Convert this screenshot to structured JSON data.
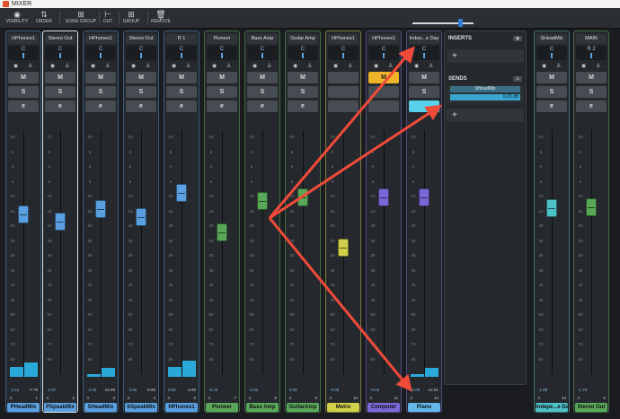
{
  "window": {
    "title": "MIXER"
  },
  "toolbar": {
    "buttons": [
      {
        "label": "VISIBILITY",
        "icon": "eye-icon"
      },
      {
        "label": "ORDER",
        "icon": "order-icon"
      },
      {
        "label": "SONG GROUP",
        "icon": "song-group-icon"
      },
      {
        "label": "OUT",
        "icon": "out-icon"
      },
      {
        "label": "GROUP",
        "icon": "group-icon"
      },
      {
        "label": "REMOVE",
        "icon": "trash-icon"
      }
    ]
  },
  "strip_buttons": {
    "mute": "M",
    "solo": "S",
    "edit": "e"
  },
  "strips": [
    {
      "name": "HPhones1",
      "pan": "C",
      "fader_db": -3.12,
      "val_l": "-3.12",
      "val_r": "-7.79",
      "num": "1",
      "label": "PHeadMix",
      "color": "#5aa0e0",
      "accent": "blue",
      "meter": [
        0.14,
        0.2
      ]
    },
    {
      "name": "Stereo Out",
      "pan": "C",
      "fader_db": -4.37,
      "val_l": "-4.37",
      "val_r": "",
      "num": "2",
      "label": "PSpeakMix",
      "color": "#5aa0e0",
      "accent": "blue",
      "selected": true,
      "meter": [
        0,
        0
      ]
    },
    {
      "name": "HPhones1",
      "pan": "C",
      "fader_db": -2.05,
      "val_l": "-2.05",
      "val_r": "-14.95",
      "num": "3",
      "label": "SHeadMix",
      "color": "#5aa0e0",
      "accent": "blue",
      "meter": [
        0.04,
        0.12
      ]
    },
    {
      "name": "Stereo Out",
      "pan": "C",
      "fader_db": -3.56,
      "val_l": "-3.56",
      "val_r": "-8.95",
      "num": "4",
      "label": "SSpeakMix",
      "color": "#5aa0e0",
      "accent": "blue",
      "meter": [
        0,
        0
      ]
    },
    {
      "name": "R 1",
      "pan": "C",
      "fader_db": 0.82,
      "val_l": "0.82",
      "val_r": "-3.60",
      "num": "6",
      "label": "HPhones1",
      "color": "#5aa0e0",
      "accent": "blue",
      "meter": [
        0.14,
        0.23
      ]
    },
    {
      "name": "Pioneer",
      "pan": "C",
      "fader_db": -6.29,
      "val_l": "-6.29",
      "val_r": "",
      "num": "7",
      "label": "Pioneer",
      "color": "#59a859",
      "accent": "green",
      "meter": [
        0,
        0
      ]
    },
    {
      "name": "Bass Amp",
      "pan": "C",
      "fader_db": -0.63,
      "val_l": "-0.63",
      "val_r": "",
      "num": "8",
      "label": "Bass Amp",
      "color": "#59a859",
      "accent": "green",
      "meter": [
        0,
        0
      ]
    },
    {
      "name": "Guitar Amp",
      "pan": "C",
      "fader_db": 0.0,
      "val_l": "0.00",
      "val_r": "",
      "num": "9",
      "label": "GuitarAmp",
      "color": "#59a859",
      "accent": "green",
      "meter": [
        0,
        0
      ]
    },
    {
      "name": "HPhones1",
      "pan": "C",
      "fader_db": -9.06,
      "val_l": "-9.06",
      "val_r": "",
      "num": "10",
      "label": "Metro",
      "color": "#d2d04a",
      "accent": "yellow",
      "meter": [
        0,
        0
      ]
    },
    {
      "name": "HPhones1",
      "pan": "C",
      "fader_db": -0.02,
      "val_l": "-0.02",
      "val_r": "",
      "num": "11",
      "label": "Computer",
      "color": "#7a68d8",
      "accent": "purple",
      "meter": [
        0,
        0
      ]
    },
    {
      "name": "Indep...e Day",
      "pan": "C",
      "fader_db": -0.05,
      "val_l": "-0.05",
      "val_r": "-12.91",
      "num": "12",
      "label": "Piano",
      "color": "#7a68d8",
      "accent": "purple",
      "label_color": "#62b8e8",
      "meter": [
        0.04,
        0.12
      ]
    },
    {
      "name": "SHeadMix",
      "pan": "C",
      "fader_db": -1.88,
      "val_l": "-1.88",
      "val_r": "",
      "num": "13",
      "label": "Indepe...e Day",
      "color": "#4ec0c8",
      "accent": "teal",
      "meter": [
        0,
        0
      ]
    },
    {
      "name": "MAIN",
      "pan": "R 2",
      "fader_db": -1.79,
      "val_l": "-1.79",
      "val_r": "",
      "num": "5",
      "label": "Stereo Out",
      "color": "#59a859",
      "accent": "green",
      "meter": [
        0,
        0
      ]
    }
  ],
  "inserts_panel": {
    "inserts_label": "INSERTS",
    "sends_label": "SENDS",
    "add_symbol": "+",
    "send_name": "SHeadMix",
    "send_level": "0.00 dB"
  },
  "scale_ticks": [
    "10",
    "5",
    "0",
    "5",
    "10",
    "15",
    "20",
    "25",
    "30",
    "35",
    "40",
    "45",
    "50",
    "60",
    "70",
    "80"
  ],
  "colors": {
    "arrow": "#f04a3a",
    "accent_yellow": "#f0b429",
    "accent_cyan": "#58d2ea"
  }
}
